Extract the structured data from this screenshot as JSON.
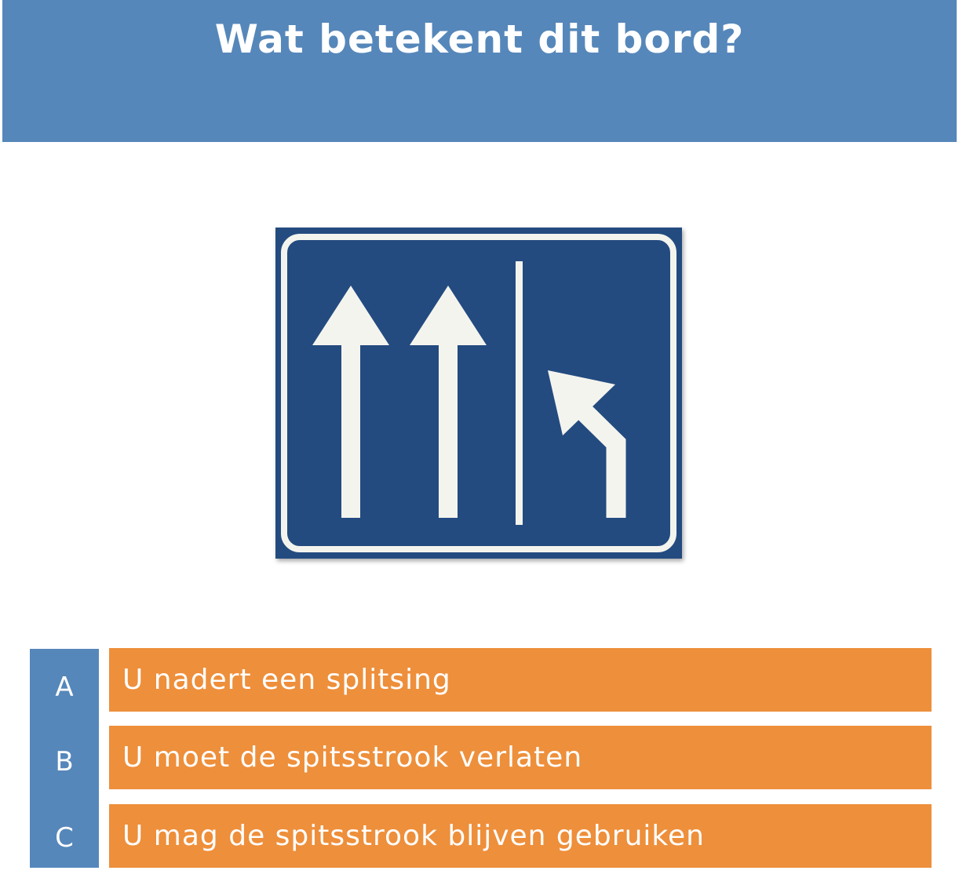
{
  "header": {
    "title": "Wat betekent dit bord?"
  },
  "sign": {
    "icon": "lane-split-sign-icon",
    "background_color": "#234b80",
    "symbol_color": "#f4f4ee"
  },
  "answers": [
    {
      "letter": "A",
      "text": "U nadert een splitsing"
    },
    {
      "letter": "B",
      "text": "U moet de spitsstrook verlaten"
    },
    {
      "letter": "C",
      "text": "U mag de spitsstrook blijven gebruiken"
    }
  ],
  "colors": {
    "header": "#5687ba",
    "answer": "#ee8f3b",
    "letter_column": "#5687ba"
  }
}
